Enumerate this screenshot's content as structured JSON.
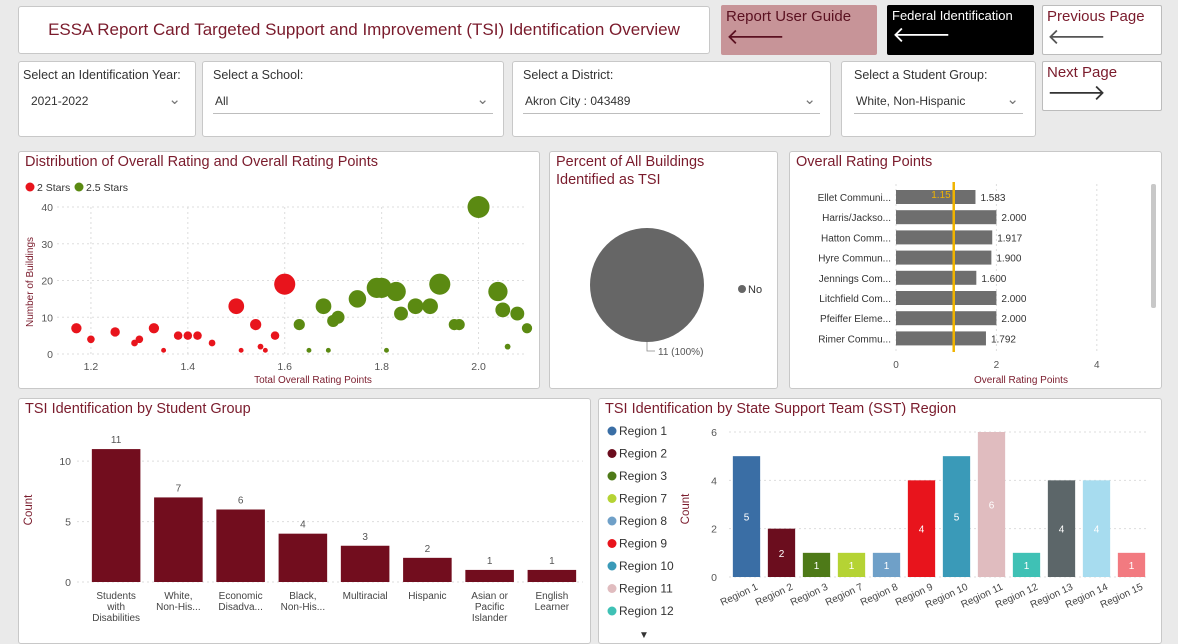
{
  "header": {
    "title": "ESSA Report Card Targeted Support and Improvement (TSI) Identification Overview",
    "guide_label": "Report User Guide",
    "federal_label": "Federal Identification",
    "prev_label": "Previous Page",
    "next_label": "Next Page",
    "arrow_left": "🡐",
    "arrow_right": "🡒"
  },
  "filters": {
    "year": {
      "label": "Select an Identification Year:",
      "value": "2021-2022"
    },
    "school": {
      "label": "Select a School:",
      "value": "All"
    },
    "district": {
      "label": "Select a District:",
      "value": "Akron City : 043489"
    },
    "group": {
      "label": "Select a Student Group:",
      "value": "White, Non-Hispanic"
    }
  },
  "scatter": {
    "title": "Distribution of Overall Rating and Overall Rating Points",
    "legend": [
      {
        "name": "2 Stars",
        "color": "#e8141c"
      },
      {
        "name": "2.5 Stars",
        "color": "#5b8a12"
      }
    ],
    "ylabel": "Number of Buildings",
    "xlabel": "Total Overall Rating Points"
  },
  "pie": {
    "title_line1": "Percent of All Buildings",
    "title_line2": "Identified as TSI",
    "legend": "No",
    "label": "11 (100%)"
  },
  "rating": {
    "title": "Overall Rating Points",
    "xlabel": "Overall Rating Points",
    "ref_label": "1.15"
  },
  "group_chart": {
    "title": "TSI Identification by Student Group",
    "ylabel": "Count"
  },
  "sst_chart": {
    "title": "TSI Identification by State Support Team (SST) Region",
    "ylabel": "Count",
    "more_icon": "▼"
  },
  "chart_data": [
    {
      "type": "scatter",
      "title": "Distribution of Overall Rating and Overall Rating Points",
      "xlabel": "Total Overall Rating Points",
      "ylabel": "Number of Buildings",
      "xlim": [
        1.13,
        2.1
      ],
      "ylim": [
        0,
        40
      ],
      "xticks": [
        "1.2",
        "1.4",
        "1.6",
        "1.8",
        "2.0"
      ],
      "yticks": [
        "0",
        "10",
        "20",
        "30",
        "40"
      ],
      "series": [
        {
          "name": "2 Stars",
          "color": "#e8141c",
          "points": [
            {
              "x": 1.17,
              "y": 7
            },
            {
              "x": 1.2,
              "y": 4
            },
            {
              "x": 1.25,
              "y": 6
            },
            {
              "x": 1.29,
              "y": 3
            },
            {
              "x": 1.3,
              "y": 4
            },
            {
              "x": 1.33,
              "y": 7
            },
            {
              "x": 1.35,
              "y": 1
            },
            {
              "x": 1.38,
              "y": 5
            },
            {
              "x": 1.4,
              "y": 5
            },
            {
              "x": 1.42,
              "y": 5
            },
            {
              "x": 1.45,
              "y": 3
            },
            {
              "x": 1.5,
              "y": 13
            },
            {
              "x": 1.51,
              "y": 1
            },
            {
              "x": 1.54,
              "y": 8
            },
            {
              "x": 1.55,
              "y": 2
            },
            {
              "x": 1.56,
              "y": 1
            },
            {
              "x": 1.58,
              "y": 5
            },
            {
              "x": 1.6,
              "y": 19
            }
          ]
        },
        {
          "name": "2.5 Stars",
          "color": "#5b8a12",
          "points": [
            {
              "x": 1.63,
              "y": 8
            },
            {
              "x": 1.65,
              "y": 1
            },
            {
              "x": 1.68,
              "y": 13
            },
            {
              "x": 1.69,
              "y": 1
            },
            {
              "x": 1.7,
              "y": 9
            },
            {
              "x": 1.71,
              "y": 10
            },
            {
              "x": 1.75,
              "y": 15
            },
            {
              "x": 1.79,
              "y": 18
            },
            {
              "x": 1.8,
              "y": 18
            },
            {
              "x": 1.81,
              "y": 1
            },
            {
              "x": 1.83,
              "y": 17
            },
            {
              "x": 1.84,
              "y": 11
            },
            {
              "x": 1.87,
              "y": 13
            },
            {
              "x": 1.9,
              "y": 13
            },
            {
              "x": 1.92,
              "y": 19
            },
            {
              "x": 1.95,
              "y": 8
            },
            {
              "x": 1.96,
              "y": 8
            },
            {
              "x": 2.0,
              "y": 40
            },
            {
              "x": 2.04,
              "y": 17
            },
            {
              "x": 2.05,
              "y": 12
            },
            {
              "x": 2.06,
              "y": 2
            },
            {
              "x": 2.08,
              "y": 11
            },
            {
              "x": 2.1,
              "y": 7
            }
          ]
        }
      ]
    },
    {
      "type": "pie",
      "title": "Percent of All Buildings Identified as TSI",
      "slices": [
        {
          "label": "No",
          "value": 11,
          "percent": 100,
          "color": "#666666"
        }
      ]
    },
    {
      "type": "bar",
      "orientation": "horizontal",
      "title": "Overall Rating Points",
      "xlabel": "Overall Rating Points",
      "xlim": [
        0,
        5
      ],
      "xticks": [
        "0",
        "2",
        "4"
      ],
      "reference_line": 1.15,
      "categories": [
        "Ellet Communi...",
        "Harris/Jackso...",
        "Hatton Comm...",
        "Hyre Commun...",
        "Jennings Com...",
        "Litchfield Com...",
        "Pfeiffer Eleme...",
        "Rimer Commu..."
      ],
      "values": [
        1.583,
        2.0,
        1.917,
        1.9,
        1.6,
        2.0,
        2.0,
        1.792
      ],
      "value_labels": [
        "1.583",
        "2.000",
        "1.917",
        "1.900",
        "1.600",
        "2.000",
        "2.000",
        "1.792"
      ],
      "color": "#6e6e6e"
    },
    {
      "type": "bar",
      "title": "TSI Identification by Student Group",
      "ylabel": "Count",
      "ylim": [
        0,
        12
      ],
      "yticks": [
        "0",
        "5",
        "10"
      ],
      "categories": [
        [
          "Students",
          "with",
          "Disabilities"
        ],
        [
          "White,",
          "Non-His..."
        ],
        [
          "Economic",
          "Disadva..."
        ],
        [
          "Black,",
          "Non-His..."
        ],
        [
          "Multiracial"
        ],
        [
          "Hispanic"
        ],
        [
          "Asian or",
          "Pacific",
          "Islander"
        ],
        [
          "English",
          "Learner"
        ]
      ],
      "values": [
        11,
        7,
        6,
        4,
        3,
        2,
        1,
        1
      ],
      "color": "#720d1e"
    },
    {
      "type": "bar",
      "title": "TSI Identification by State Support Team (SST) Region",
      "ylabel": "Count",
      "ylim": [
        0,
        6
      ],
      "yticks": [
        "0",
        "2",
        "4",
        "6"
      ],
      "categories": [
        "Region 1",
        "Region 2",
        "Region 3",
        "Region 7",
        "Region 8",
        "Region 9",
        "Region 10",
        "Region 11",
        "Region 12",
        "Region 13",
        "Region 14",
        "Region 15"
      ],
      "values": [
        5,
        2,
        1,
        1,
        1,
        4,
        5,
        6,
        1,
        4,
        4,
        1
      ],
      "colors": [
        "#3a6ea5",
        "#6b0d1e",
        "#4e7a18",
        "#b5d334",
        "#6fa0c8",
        "#e8141c",
        "#3a9ab8",
        "#e0bcbf",
        "#3fc1b5",
        "#5c6669",
        "#a7dcef",
        "#f27a80"
      ],
      "legend_visible": [
        "Region 1",
        "Region 2",
        "Region 3",
        "Region 7",
        "Region 8",
        "Region 9",
        "Region 10",
        "Region 11",
        "Region 12"
      ]
    }
  ]
}
